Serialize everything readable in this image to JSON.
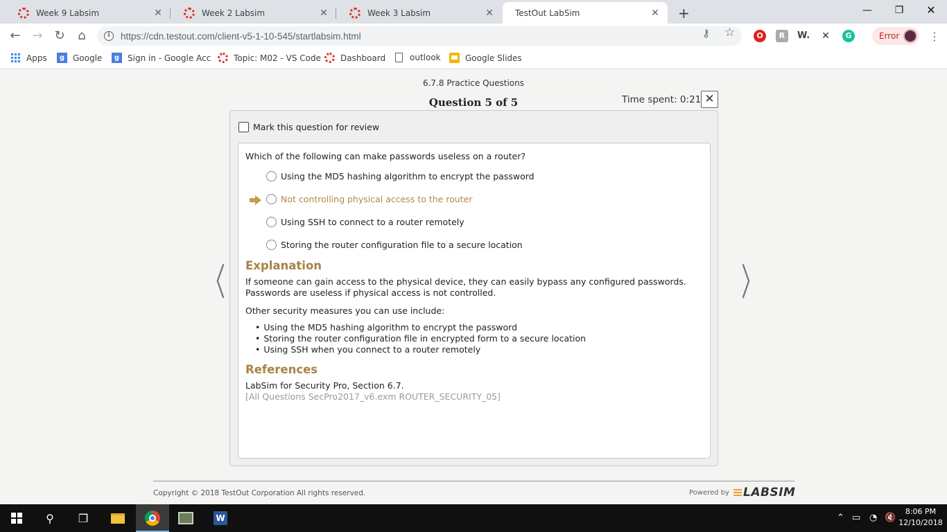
{
  "browser": {
    "tabs": [
      {
        "title": "Week 9 Labsim"
      },
      {
        "title": "Week 2 Labsim"
      },
      {
        "title": "Week 3 Labsim"
      },
      {
        "title": "TestOut LabSim"
      }
    ],
    "url_domain": "https://cdn.testout.com",
    "url_path": "/client-v5-1-10-545/startlabsim.html",
    "error_label": "Error",
    "bookmarks": [
      {
        "label": "Apps"
      },
      {
        "label": "Google"
      },
      {
        "label": "Sign in - Google Acc"
      },
      {
        "label": "Topic: M02 - VS Code"
      },
      {
        "label": "Dashboard"
      },
      {
        "label": "outlook"
      },
      {
        "label": "Google Slides"
      }
    ]
  },
  "quiz": {
    "section": "6.7.8 Practice Questions",
    "question_number": "Question 5 of 5",
    "time_spent": "Time spent: 0:21",
    "mark_label": "Mark this question for review",
    "question": "Which of the following can make passwords useless on a router?",
    "options": [
      {
        "text": "Using the MD5 hashing algorithm to encrypt the password",
        "correct": false
      },
      {
        "text": "Not controlling physical access to the router",
        "correct": true
      },
      {
        "text": "Using SSH to connect to a router remotely",
        "correct": false
      },
      {
        "text": "Storing the router configuration file to a secure location",
        "correct": false
      }
    ],
    "explanation_heading": "Explanation",
    "explanation_p1": "If someone can gain access to the physical device, they can easily bypass any configured passwords. Passwords are useless if physical access is not controlled.",
    "explanation_p2": "Other security measures you can use include:",
    "explanation_bullets": [
      "Using the MD5 hashing algorithm to encrypt the password",
      "Storing the router configuration file in encrypted form to a secure location",
      "Using SSH when you connect to a router remotely"
    ],
    "references_heading": "References",
    "reference_line": "LabSim for Security Pro, Section 6.7.",
    "reference_id": "[All Questions SecPro2017_v6.exm ROUTER_SECURITY_05]"
  },
  "footer": {
    "copyright": "Copyright © 2018  TestOut Corporation All rights reserved.",
    "powered_by": "Powered by",
    "logo": "LABSIM"
  },
  "taskbar": {
    "time": "8:06 PM",
    "date": "12/10/2018"
  },
  "colors": {
    "accent_gold": "#a98445",
    "correct_answer": "#b08a44"
  }
}
